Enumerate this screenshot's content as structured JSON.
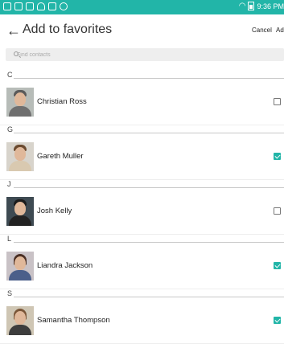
{
  "status_bar": {
    "time": "9:36 PM",
    "icons": [
      "notification-icon",
      "gallery-icon",
      "message-icon",
      "cloud-icon",
      "shop-icon",
      "download-icon"
    ],
    "wifi_icon": "wifi-icon",
    "battery_icon": "battery-icon",
    "color": "#22b5a8"
  },
  "header": {
    "title": "Add to favorites",
    "cancel_label": "Cancel",
    "add_label": "Add"
  },
  "search": {
    "placeholder": "Find contacts"
  },
  "sections": [
    {
      "letter": "C",
      "contact": {
        "name": "Christian Ross",
        "checked": false
      }
    },
    {
      "letter": "G",
      "contact": {
        "name": "Gareth Muller",
        "checked": true
      }
    },
    {
      "letter": "J",
      "contact": {
        "name": "Josh Kelly",
        "checked": false
      }
    },
    {
      "letter": "L",
      "contact": {
        "name": "Liandra Jackson",
        "checked": true
      }
    },
    {
      "letter": "S",
      "contact": {
        "name": "Samantha Thompson",
        "checked": true
      }
    }
  ],
  "accent_color": "#22b5a8"
}
